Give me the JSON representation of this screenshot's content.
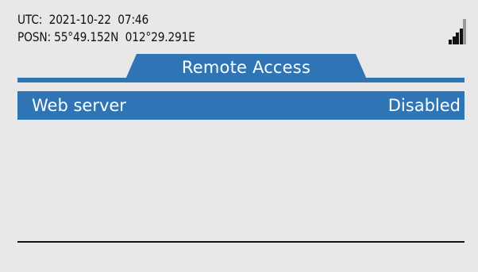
{
  "status": {
    "utc_label": "UTC:",
    "utc_value": "2021-10-22  07:46",
    "posn_label": "POSN:",
    "posn_value": "55°49.152N  012°29.291E",
    "signal_icon": "signal-strength-icon",
    "signal_level": 4,
    "signal_max": 5
  },
  "tab": {
    "label": "Remote Access"
  },
  "menu": {
    "items": [
      {
        "label": "Web server",
        "value": "Disabled"
      }
    ]
  },
  "colors": {
    "accent": "#2f74b5",
    "background": "#e8e8e8",
    "signal_active": "#111111",
    "signal_inactive": "#9a9a9a"
  }
}
